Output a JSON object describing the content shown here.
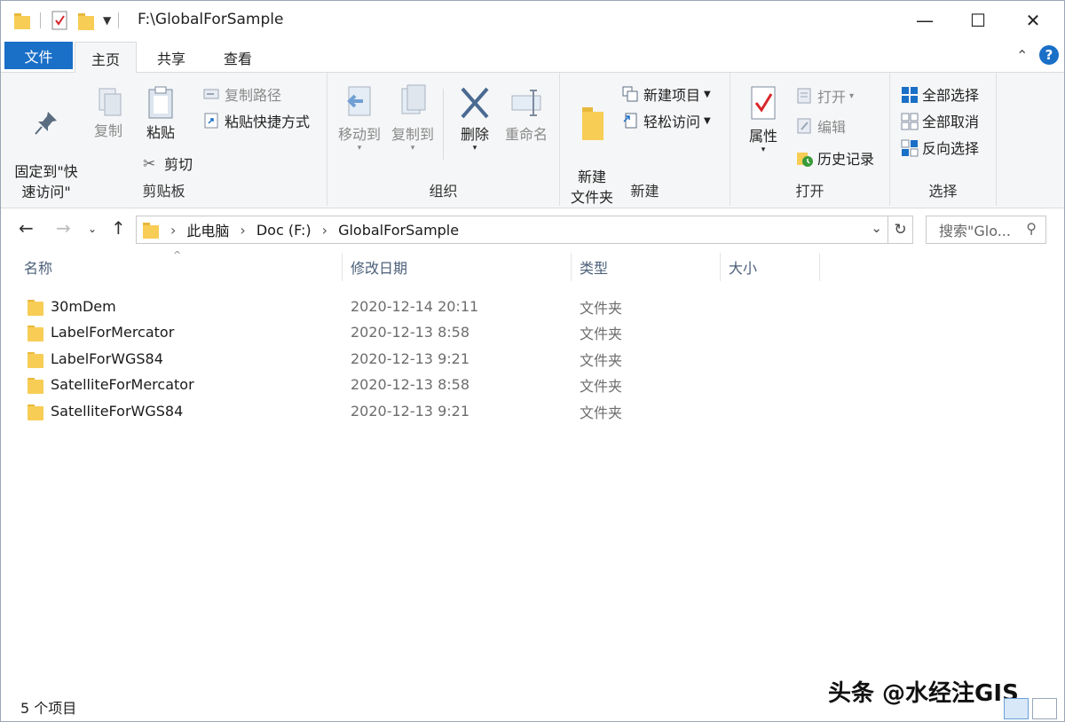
{
  "window": {
    "title": "F:\\GlobalForSample"
  },
  "menu": {
    "file": "文件",
    "tabs": [
      "主页",
      "共享",
      "查看"
    ]
  },
  "ribbon": {
    "clipboard": {
      "label": "剪贴板",
      "pin": "固定到\"快\n速访问\"",
      "copy": "复制",
      "paste": "粘贴",
      "copy_path": "复制路径",
      "paste_shortcut": "粘贴快捷方式",
      "cut": "剪切"
    },
    "organize": {
      "label": "组织",
      "move_to": "移动到",
      "copy_to": "复制到",
      "delete": "删除",
      "rename": "重命名"
    },
    "new": {
      "label": "新建",
      "new_folder": "新建\n文件夹",
      "new_item": "新建项目",
      "easy_access": "轻松访问"
    },
    "open": {
      "label": "打开",
      "properties": "属性",
      "open": "打开",
      "edit": "编辑",
      "history": "历史记录"
    },
    "select": {
      "label": "选择",
      "select_all": "全部选择",
      "select_none": "全部取消",
      "invert": "反向选择"
    }
  },
  "address": {
    "crumbs": [
      "此电脑",
      "Doc (F:)",
      "GlobalForSample"
    ],
    "search_placeholder": "搜索\"Glo..."
  },
  "columns": {
    "name": "名称",
    "modified": "修改日期",
    "type": "类型",
    "size": "大小"
  },
  "files": [
    {
      "name": "30mDem",
      "modified": "2020-12-14 20:11",
      "type": "文件夹"
    },
    {
      "name": "LabelForMercator",
      "modified": "2020-12-13 8:58",
      "type": "文件夹"
    },
    {
      "name": "LabelForWGS84",
      "modified": "2020-12-13 9:21",
      "type": "文件夹"
    },
    {
      "name": "SatelliteForMercator",
      "modified": "2020-12-13 8:58",
      "type": "文件夹"
    },
    {
      "name": "SatelliteForWGS84",
      "modified": "2020-12-13 9:21",
      "type": "文件夹"
    }
  ],
  "status": {
    "count": "5 个项目"
  },
  "watermark": "头条 @水经注GIS"
}
